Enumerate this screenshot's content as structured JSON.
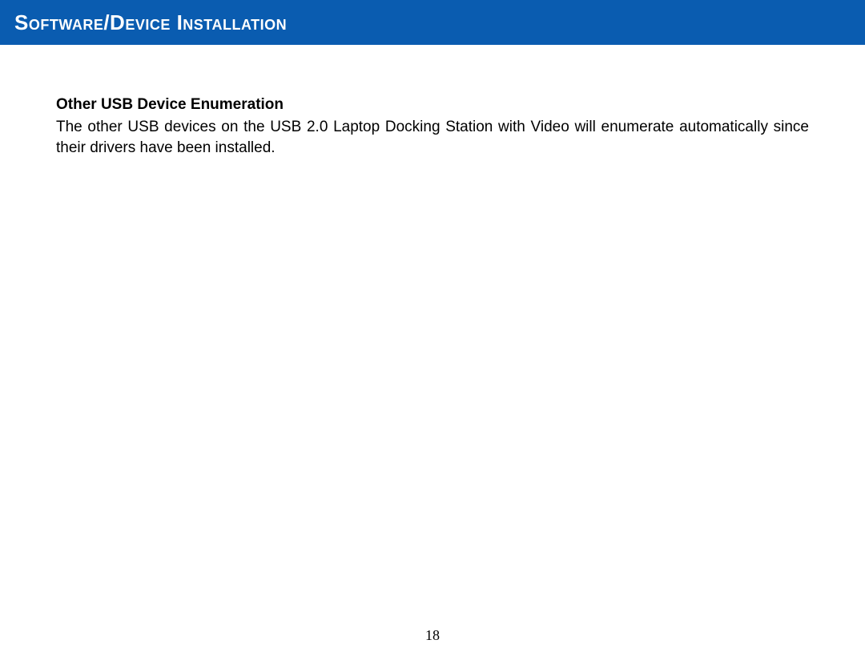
{
  "header": {
    "title": "Software/Device Installation"
  },
  "section": {
    "heading": "Other USB Device Enumeration",
    "body": "The other USB devices on the USB 2.0 Laptop Docking Station with Video will enumerate automatically since their drivers have been installed."
  },
  "page_number": "18",
  "colors": {
    "header_bg": "#0a5cb0",
    "header_text": "#ffffff",
    "body_text": "#000000"
  }
}
